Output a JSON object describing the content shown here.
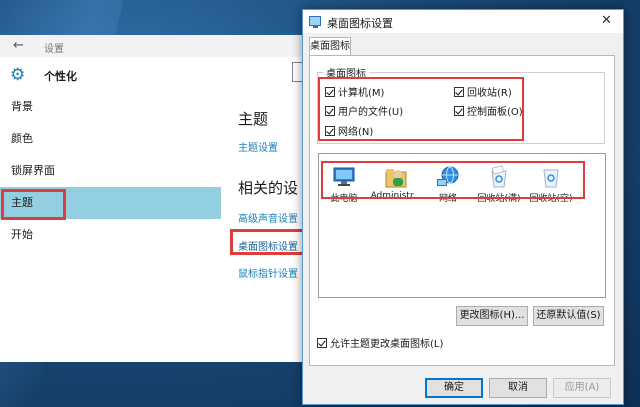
{
  "settings": {
    "back_icon": "back-arrow-icon",
    "app_title": "设置",
    "header_icon": "gear-icon",
    "page_name": "个性化",
    "nav_items": [
      "背景",
      "颜色",
      "锁屏界面",
      "主题",
      "开始"
    ],
    "selected_nav": "主题",
    "section_title": "主题",
    "theme_settings_link": "主题设置",
    "related_title": "相关的设",
    "related_links": [
      "高级声音设置",
      "桌面图标设置",
      "鼠标指针设置"
    ]
  },
  "dialog": {
    "title": "桌面图标设置",
    "close_icon": "close-icon",
    "tab_label": "桌面图标",
    "group_label": "桌面图标",
    "checkboxes": [
      {
        "label": "计算机(M)",
        "checked": true
      },
      {
        "label": "回收站(R)",
        "checked": true
      },
      {
        "label": "用户的文件(U)",
        "checked": true
      },
      {
        "label": "控制面板(O)",
        "checked": true
      },
      {
        "label": "网络(N)",
        "checked": true
      }
    ],
    "icons": [
      {
        "label": "此电脑",
        "icon": "this-pc-icon"
      },
      {
        "label": "Administr...",
        "icon": "user-folder-icon"
      },
      {
        "label": "网络",
        "icon": "network-icon"
      },
      {
        "label": "回收站(满)",
        "icon": "recycle-bin-full-icon"
      },
      {
        "label": "回收站(空)",
        "icon": "recycle-bin-empty-icon"
      }
    ],
    "change_icon_button": "更改图标(H)...",
    "restore_default_button": "还原默认值(S)",
    "allow_themes_checkbox": {
      "label": "允许主题更改桌面图标(L)",
      "checked": true
    },
    "ok_button": "确定",
    "cancel_button": "取消",
    "apply_button": "应用(A)"
  },
  "colors": {
    "accent": "#1a7fb5",
    "selected_nav_bg": "#93cfe0",
    "highlight_red": "#e03c3c"
  }
}
